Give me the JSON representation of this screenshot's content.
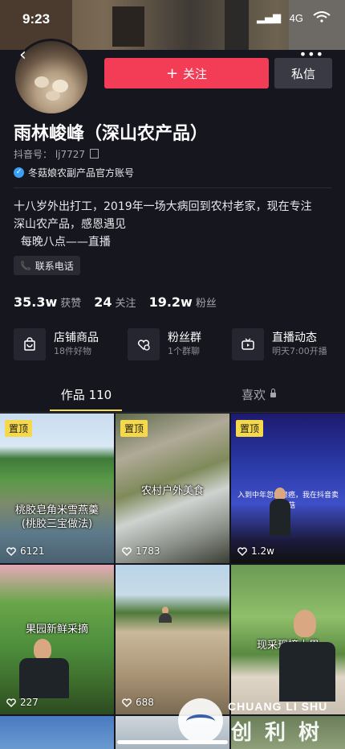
{
  "status_bar": {
    "time": "9:23",
    "network": "4G"
  },
  "header": {
    "follow_label": "关注",
    "message_label": "私信"
  },
  "profile": {
    "name": "雨林峻峰（深山农产品）",
    "douyin_id": "抖音号： lj7727",
    "verified_text": "冬菇娘农副产品官方账号",
    "bio_lines": [
      "十八岁外出打工，2019年一场大病回到农村老家，现在专注",
      "深山农产品，感恩遇见",
      "  每晚八点——直播"
    ],
    "phone_label": "联系电话"
  },
  "stats": [
    {
      "value": "35.3w",
      "label": "获赞"
    },
    {
      "value": "24",
      "label": "关注"
    },
    {
      "value": "19.2w",
      "label": "粉丝"
    }
  ],
  "features": [
    {
      "title": "店铺商品",
      "subtitle": "18件好物",
      "icon": "shopping-bag-icon"
    },
    {
      "title": "粉丝群",
      "subtitle": "1个群聊",
      "icon": "fans-group-icon"
    },
    {
      "title": "直播动态",
      "subtitle": "明天7:00开播",
      "icon": "live-tv-icon"
    }
  ],
  "tabs": [
    {
      "label": "作品 110"
    },
    {
      "label": "喜欢"
    }
  ],
  "pinned_label": "置顶",
  "videos": [
    {
      "caption": "桃胶皂角米雪燕羹\n(桃胶三宝做法)",
      "likes": "6121",
      "pinned": true
    },
    {
      "caption": "农村户外美食",
      "likes": "1783",
      "pinned": true
    },
    {
      "caption": "",
      "likes": "1.2w",
      "pinned": true,
      "stage_text": "入到中年忽然患癌，我在抖音卖花菇"
    },
    {
      "caption": "果园新鲜采摘",
      "likes": "227",
      "pinned": false
    },
    {
      "caption": "",
      "likes": "688",
      "pinned": false
    },
    {
      "caption": "现采现摘水果",
      "likes": "",
      "pinned": false
    }
  ],
  "watermark": {
    "en": "CHUANG LI SHU",
    "cn": "创利树"
  },
  "colors": {
    "accent_red": "#f33d57",
    "pin_yellow": "#f6d84b",
    "background": "#16161f"
  }
}
